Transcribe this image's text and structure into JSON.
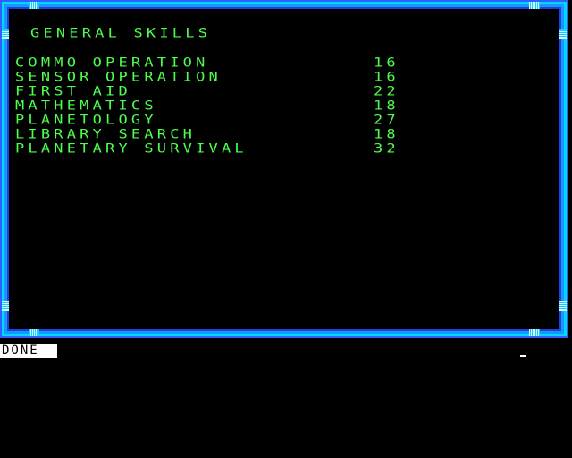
{
  "screen": {
    "title": "GENERAL SKILLS",
    "skills": [
      {
        "name": "COMMO OPERATION",
        "value": "16"
      },
      {
        "name": "SENSOR OPERATION",
        "value": "16"
      },
      {
        "name": "FIRST AID",
        "value": "22"
      },
      {
        "name": "MATHEMATICS",
        "value": "18"
      },
      {
        "name": "PLANETOLOGY",
        "value": "27"
      },
      {
        "name": "LIBRARY SEARCH",
        "value": "18"
      },
      {
        "name": "PLANETARY SURVIVAL",
        "value": "32"
      }
    ]
  },
  "footer": {
    "done_label": "DONE"
  },
  "colors": {
    "text": "#4cff4c",
    "frame_outer": "#3060ff",
    "frame_inner": "#00d8ff",
    "background": "#000000"
  }
}
